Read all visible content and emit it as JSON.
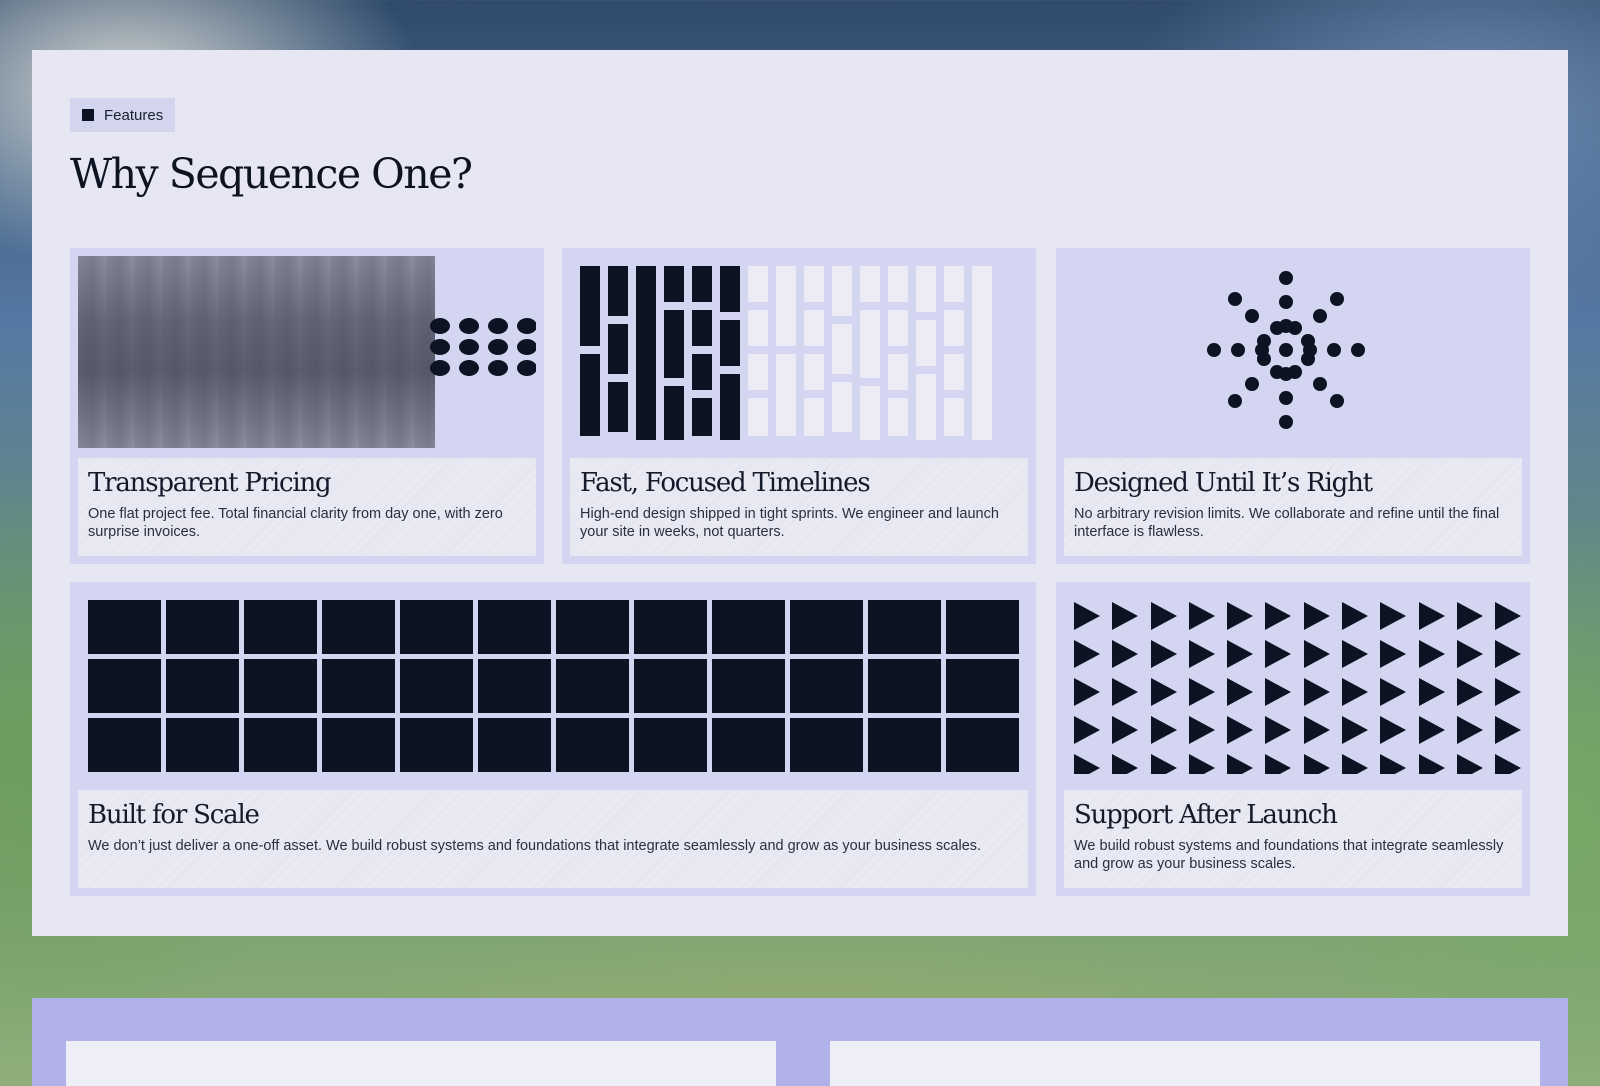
{
  "section": {
    "badge_label": "Features",
    "title": "Why Sequence One?"
  },
  "features": [
    {
      "title": "Transparent Pricing",
      "description": "One flat project fee. Total financial clarity from day one, with zero surprise invoices.",
      "illustration": "noise-block-with-dot-grid"
    },
    {
      "title": "Fast, Focused Timelines",
      "description": "High-end design shipped in tight sprints. We engineer and launch your site in weeks, not quarters.",
      "illustration": "vertical-bar-segments"
    },
    {
      "title": "Designed Until It’s Right",
      "description": "No arbitrary revision limits. We collaborate and refine until the final interface is flawless.",
      "illustration": "radial-dot-burst"
    },
    {
      "title": "Built for Scale",
      "description": "We don’t just deliver a one-off asset. We build robust systems and foundations that integrate seamlessly and grow as your business scales.",
      "illustration": "block-grid"
    },
    {
      "title": "Support After Launch",
      "description": "We build robust systems and foundations that integrate seamlessly and grow as your business scales.",
      "illustration": "play-triangle-grid"
    }
  ],
  "colors": {
    "ink": "#0c1323",
    "panel": "#e6e7f3",
    "card": "#d4d5f0",
    "lower_panel": "#b0b1e8"
  }
}
